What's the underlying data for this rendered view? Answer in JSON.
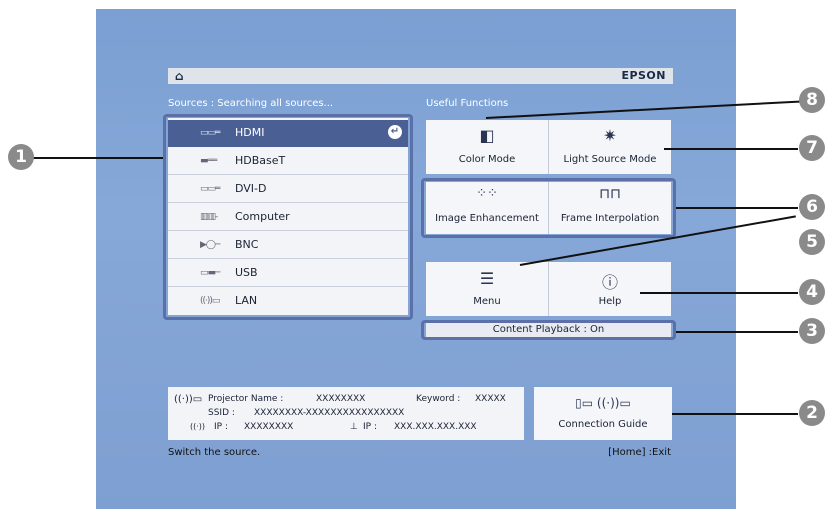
{
  "topbar": {
    "brand": "EPSON",
    "home_icon": "home-icon"
  },
  "sources_label": "Sources : Searching all sources...",
  "useful_label": "Useful Functions",
  "sources": [
    {
      "label": "HDMI",
      "icon": "hdmi-icon",
      "selected": true
    },
    {
      "label": "HDBaseT",
      "icon": "hdbaset-icon"
    },
    {
      "label": "DVI-D",
      "icon": "dvid-icon"
    },
    {
      "label": "Computer",
      "icon": "computer-icon"
    },
    {
      "label": "BNC",
      "icon": "bnc-icon"
    },
    {
      "label": "USB",
      "icon": "usb-icon"
    },
    {
      "label": "LAN",
      "icon": "lan-icon"
    }
  ],
  "functions": {
    "color_mode": "Color Mode",
    "light_source_mode": "Light Source Mode",
    "image_enhancement": "Image Enhancement",
    "frame_interpolation": "Frame Interpolation",
    "menu": "Menu",
    "help": "Help"
  },
  "content_playback": "Content Playback : On",
  "info": {
    "projector_name_label": "Projector Name :",
    "projector_name": "XXXXXXXX",
    "keyword_label": "Keyword :",
    "keyword": "XXXXX",
    "ssid_label": "SSID :",
    "ssid": "XXXXXXXX-XXXXXXXXXXXXXXXX",
    "ip_label": "IP :",
    "ip": "XXXXXXXX",
    "wired_ip_label": "IP :",
    "wired_ip": "XXX.XXX.XXX.XXX"
  },
  "connection_guide": "Connection Guide",
  "status_left": "Switch the source.",
  "status_right": "[Home] :Exit",
  "callouts": [
    "1",
    "2",
    "3",
    "4",
    "5",
    "6",
    "7",
    "8"
  ],
  "colors": {
    "accent": "#4a5f94",
    "screen_bg": "#7b9fd2",
    "callout": "#8a8a8a"
  }
}
